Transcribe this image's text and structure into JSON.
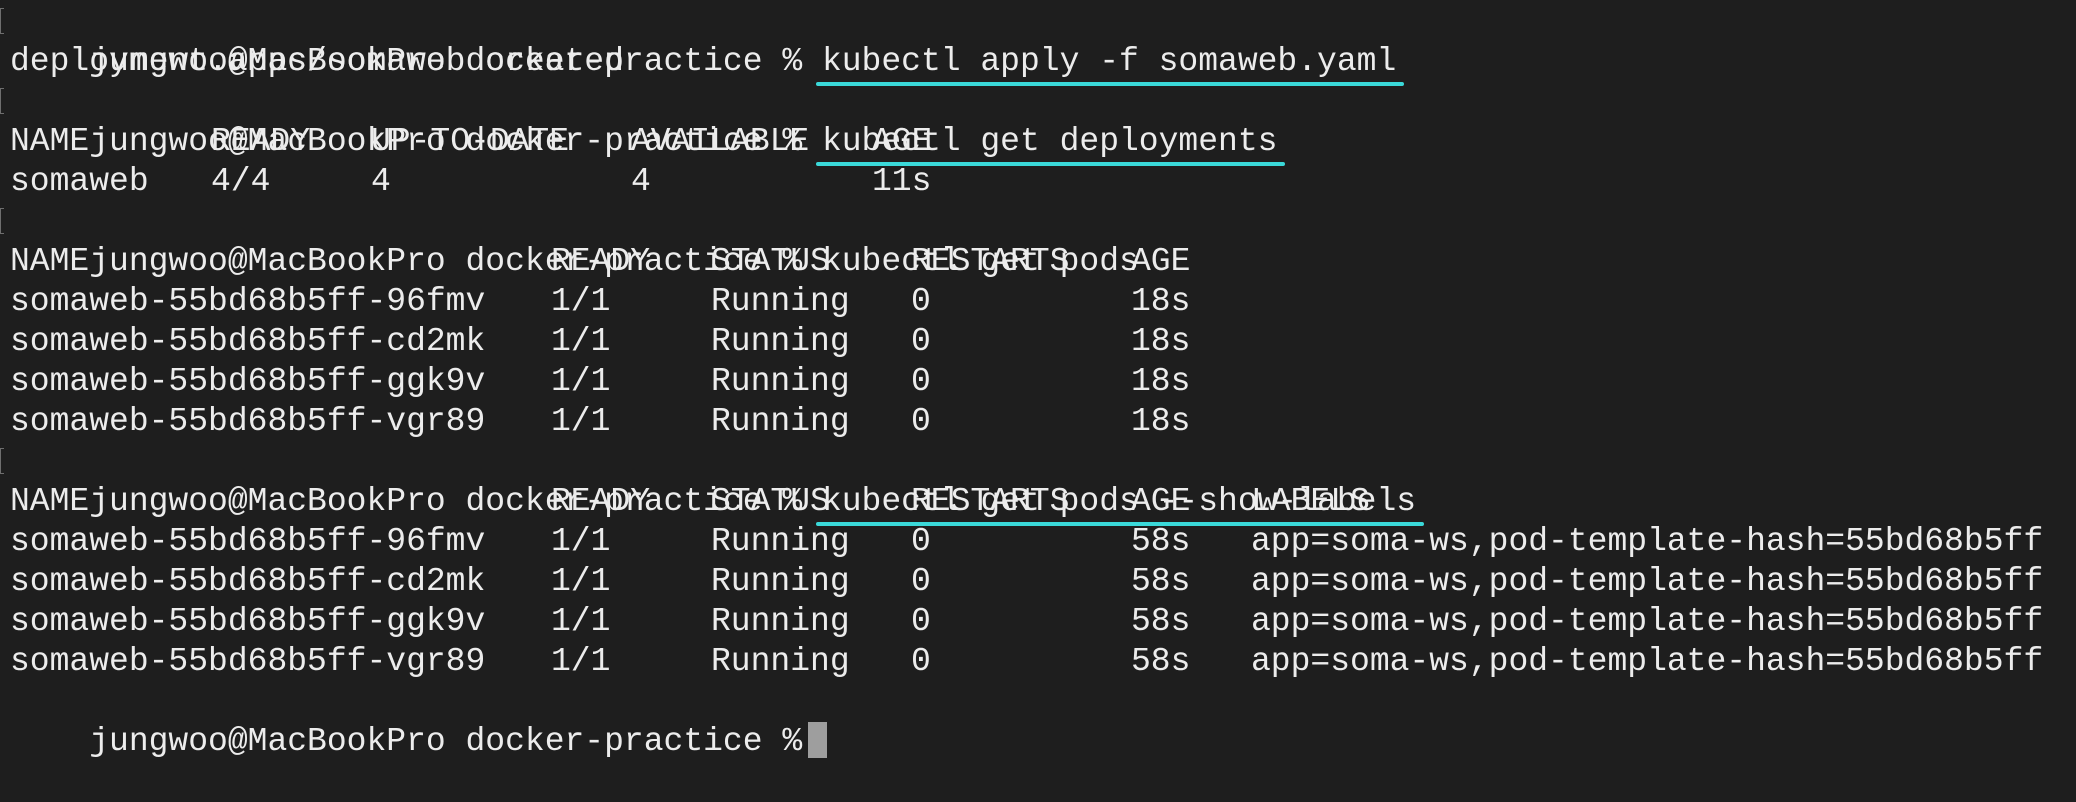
{
  "prompt": "jungwoo@MacBookPro docker-practice %",
  "commands": {
    "apply": "kubectl apply -f somaweb.yaml",
    "get_deployments": "kubectl get deployments",
    "get_pods": "kubectl get pods",
    "get_pods_labels": "kubectl get pods --show-labels"
  },
  "apply_output": "deployment.apps/somaweb created",
  "deployments": {
    "headers": [
      "NAME",
      "READY",
      "UP-TO-DATE",
      "AVAILABLE",
      "AGE"
    ],
    "rows": [
      [
        "somaweb",
        "4/4",
        "4",
        "4",
        "11s"
      ]
    ]
  },
  "pods": {
    "headers": [
      "NAME",
      "READY",
      "STATUS",
      "RESTARTS",
      "AGE"
    ],
    "rows": [
      [
        "somaweb-55bd68b5ff-96fmv",
        "1/1",
        "Running",
        "0",
        "18s"
      ],
      [
        "somaweb-55bd68b5ff-cd2mk",
        "1/1",
        "Running",
        "0",
        "18s"
      ],
      [
        "somaweb-55bd68b5ff-ggk9v",
        "1/1",
        "Running",
        "0",
        "18s"
      ],
      [
        "somaweb-55bd68b5ff-vgr89",
        "1/1",
        "Running",
        "0",
        "18s"
      ]
    ]
  },
  "pods_labels": {
    "headers": [
      "NAME",
      "READY",
      "STATUS",
      "RESTARTS",
      "AGE",
      "LABELS"
    ],
    "rows": [
      [
        "somaweb-55bd68b5ff-96fmv",
        "1/1",
        "Running",
        "0",
        "58s",
        "app=soma-ws,pod-template-hash=55bd68b5ff"
      ],
      [
        "somaweb-55bd68b5ff-cd2mk",
        "1/1",
        "Running",
        "0",
        "58s",
        "app=soma-ws,pod-template-hash=55bd68b5ff"
      ],
      [
        "somaweb-55bd68b5ff-ggk9v",
        "1/1",
        "Running",
        "0",
        "58s",
        "app=soma-ws,pod-template-hash=55bd68b5ff"
      ],
      [
        "somaweb-55bd68b5ff-vgr89",
        "1/1",
        "Running",
        "0",
        "58s",
        "app=soma-ws,pod-template-hash=55bd68b5ff"
      ]
    ]
  },
  "colors": {
    "background": "#1e1e1e",
    "text": "#ececec",
    "underline": "#3ad9d9",
    "cursor": "#9e9e9e"
  }
}
